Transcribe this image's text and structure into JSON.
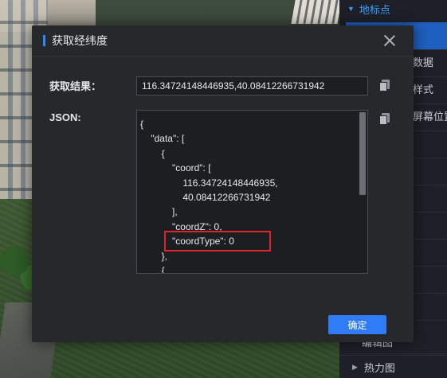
{
  "dialog": {
    "title": "获取经纬度",
    "result_label": "获取结果：",
    "result_value": "116.34724148446935,40.08412266731942",
    "json_label": "JSON:",
    "json_lines": [
      "{",
      "    \"data\": [",
      "        {",
      "            \"coord\": [",
      "                116.34724148446935,",
      "                40.08412266731942",
      "            ],",
      "            \"coordZ\": 0,",
      "            \"coordType\": 0",
      "        },",
      "        {"
    ],
    "confirm_label": "确定",
    "highlight_color": "#e0242b",
    "accent_color": "#2f7cf6"
  },
  "side_panel": {
    "section_title": "地标点",
    "items": [
      "",
      "数据",
      "样式",
      "屏幕位置",
      "",
      "",
      "",
      "",
      "",
      "",
      "",
      "编辑图"
    ],
    "footer_item": "热力图"
  },
  "icons": [
    "close-icon",
    "copy-icon",
    "caret-down-icon",
    "caret-right-icon"
  ]
}
